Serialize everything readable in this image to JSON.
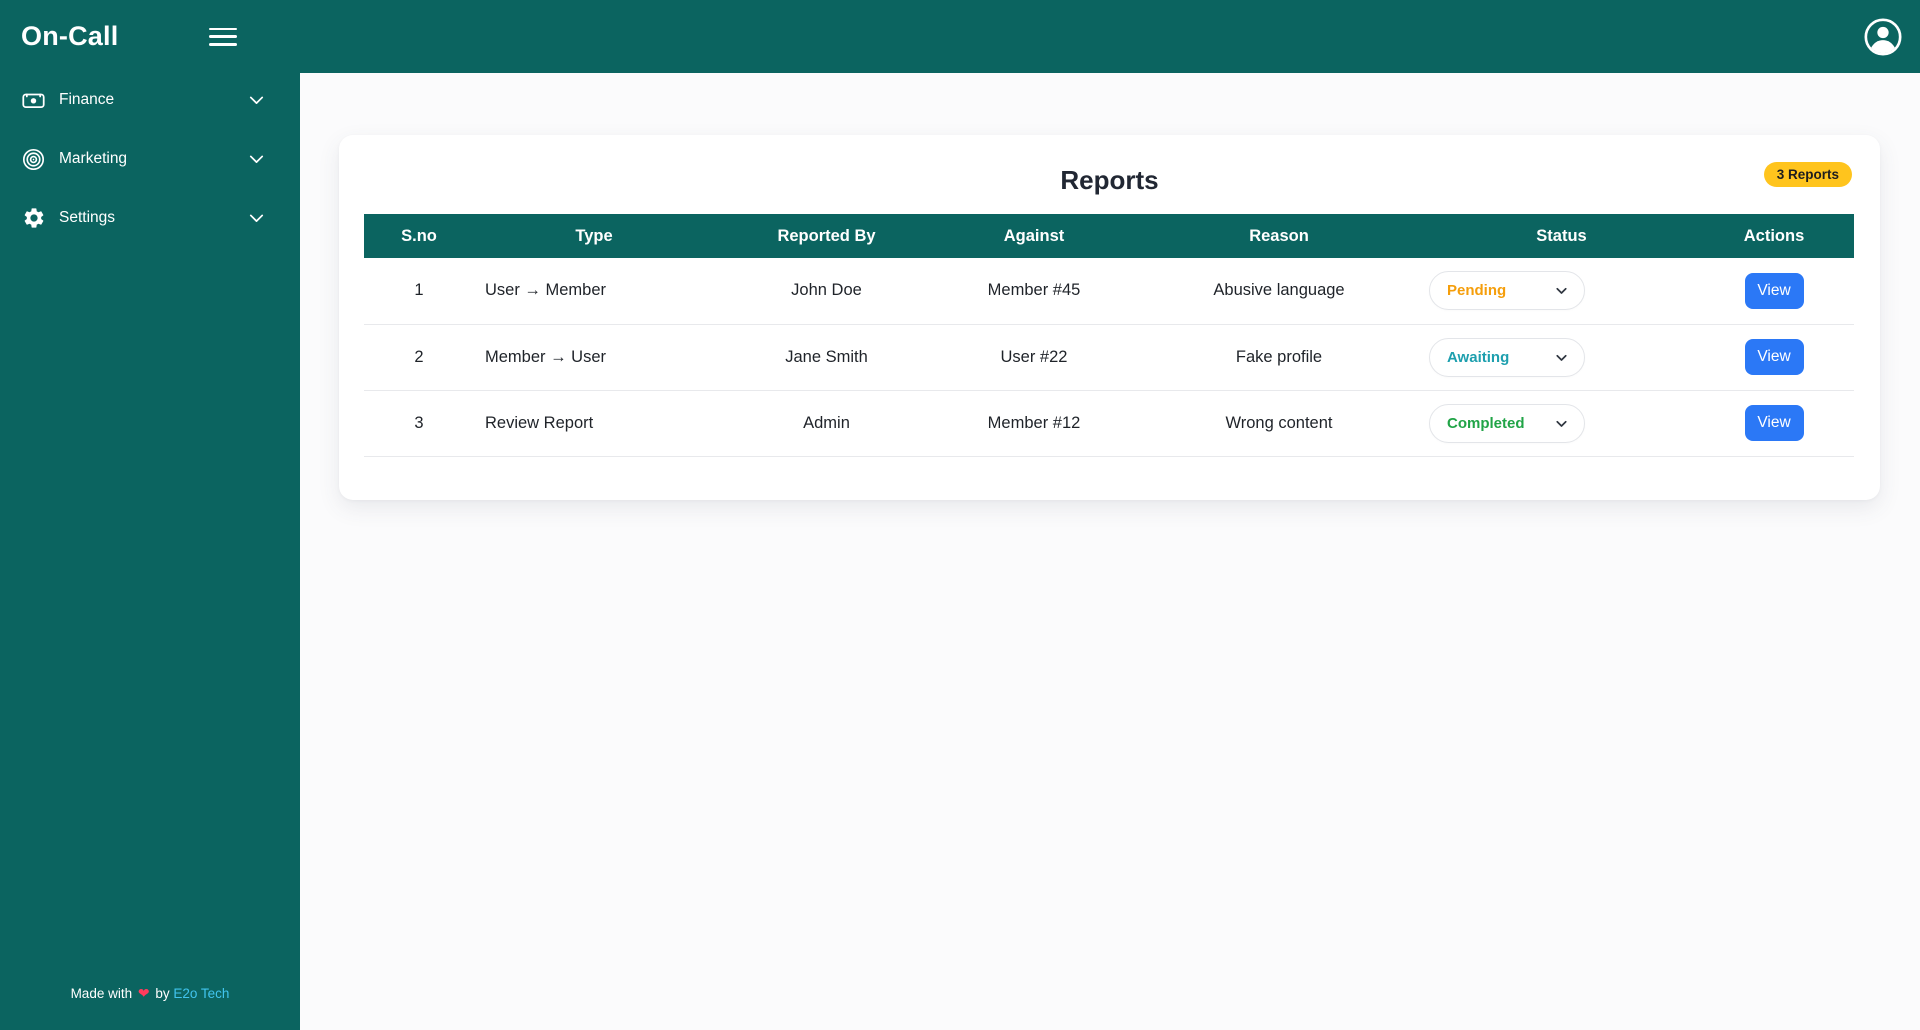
{
  "app": {
    "name": "On-Call"
  },
  "colors": {
    "teal": "#0b6460",
    "badge_bg": "#ffc41d",
    "button_blue": "#2b78f6",
    "pending": "#f59e0b",
    "awaiting": "#1d9fae",
    "completed": "#21a447",
    "footer_link": "#41c4ee"
  },
  "sidebar": {
    "items": [
      {
        "label": "Finance",
        "icon": "cash-icon"
      },
      {
        "label": "Marketing",
        "icon": "target-icon"
      },
      {
        "label": "Settings",
        "icon": "gear-icon"
      }
    ],
    "footer": {
      "prefix": "Made with",
      "heart": "❤",
      "middle": "by",
      "link": "E2o Tech"
    }
  },
  "reports": {
    "title": "Reports",
    "badge": "3 Reports",
    "columns": [
      "S.no",
      "Type",
      "Reported By",
      "Against",
      "Reason",
      "Status",
      "Actions"
    ],
    "rows": [
      {
        "sno": "1",
        "type": "User → Member",
        "reported_by": "John Doe",
        "against": "Member #45",
        "reason": "Abusive language",
        "status": "Pending",
        "status_color": "#f59e0b",
        "action": "View"
      },
      {
        "sno": "2",
        "type": "Member → User",
        "reported_by": "Jane Smith",
        "against": "User #22",
        "reason": "Fake profile",
        "status": "Awaiting",
        "status_color": "#1d9fae",
        "action": "View"
      },
      {
        "sno": "3",
        "type": "Review Report",
        "reported_by": "Admin",
        "against": "Member #12",
        "reason": "Wrong content",
        "status": "Completed",
        "status_color": "#21a447",
        "action": "View"
      }
    ]
  }
}
